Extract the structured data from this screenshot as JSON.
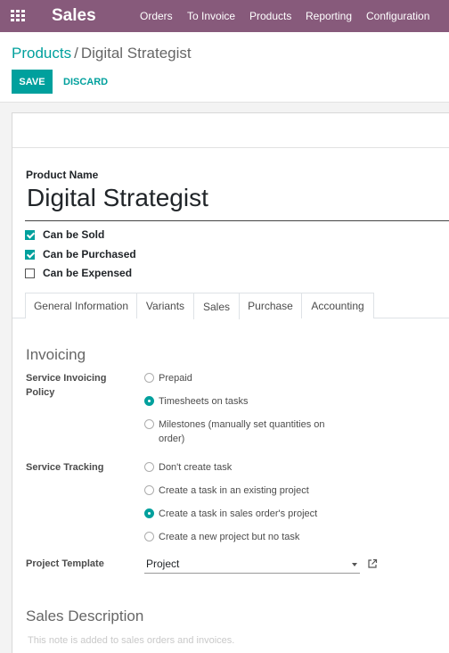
{
  "navbar": {
    "app_icon": "apps-grid-icon",
    "app_name": "Sales",
    "menu": [
      "Orders",
      "To Invoice",
      "Products",
      "Reporting",
      "Configuration"
    ]
  },
  "breadcrumb": {
    "parent": "Products",
    "separator": "/",
    "current": "Digital Strategist"
  },
  "buttons": {
    "save": "SAVE",
    "discard": "DISCARD"
  },
  "product": {
    "name_label": "Product Name",
    "name": "Digital Strategist",
    "checkboxes": [
      {
        "label": "Can be Sold",
        "checked": true
      },
      {
        "label": "Can be Purchased",
        "checked": true
      },
      {
        "label": "Can be Expensed",
        "checked": false
      }
    ]
  },
  "tabs": [
    {
      "label": "General Information",
      "active": false
    },
    {
      "label": "Variants",
      "active": false
    },
    {
      "label": "Sales",
      "active": true
    },
    {
      "label": "Purchase",
      "active": false
    },
    {
      "label": "Accounting",
      "active": false
    }
  ],
  "invoicing": {
    "title": "Invoicing",
    "service_invoicing_policy": {
      "label": "Service Invoicing Policy",
      "options": [
        {
          "label": "Prepaid",
          "selected": false
        },
        {
          "label": "Timesheets on tasks",
          "selected": true
        },
        {
          "label": "Milestones (manually set quantities on order)",
          "selected": false
        }
      ]
    },
    "service_tracking": {
      "label": "Service Tracking",
      "options": [
        {
          "label": "Don't create task",
          "selected": false
        },
        {
          "label": "Create a task in an existing project",
          "selected": false
        },
        {
          "label": "Create a task in sales order's project",
          "selected": true
        },
        {
          "label": "Create a new project but no task",
          "selected": false
        }
      ]
    },
    "project_template": {
      "label": "Project Template",
      "value": "Project"
    }
  },
  "sales_description": {
    "title": "Sales Description",
    "placeholder": "This note is added to sales orders and invoices."
  },
  "colors": {
    "brand": "#875a7b",
    "accent": "#00a09d"
  }
}
